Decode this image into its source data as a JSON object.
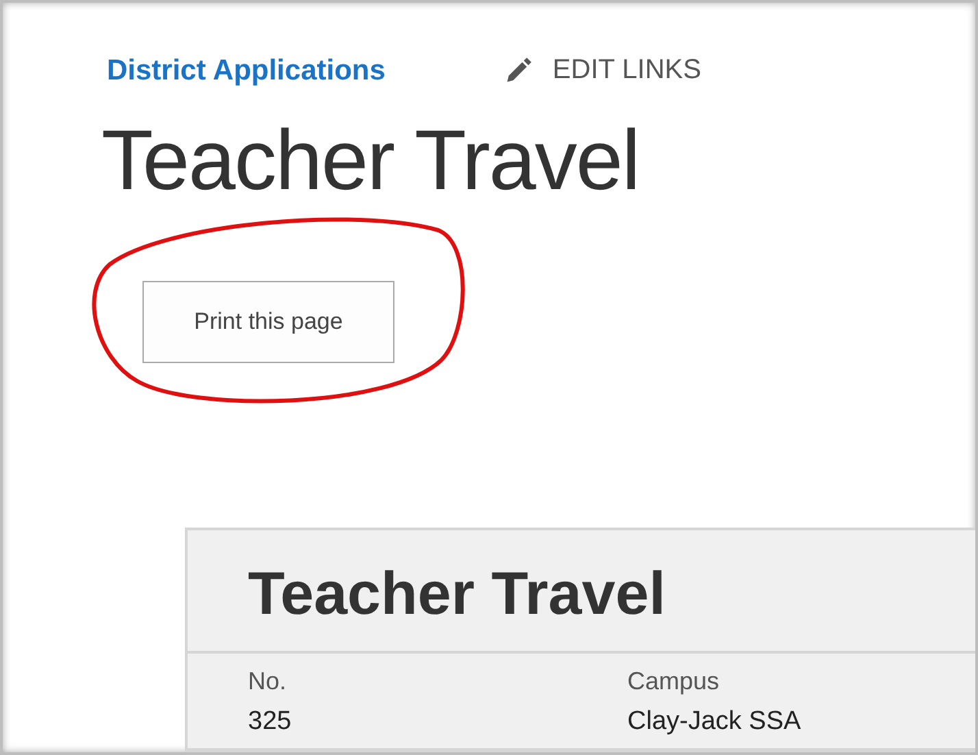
{
  "breadcrumb": {
    "link": "District Applications",
    "edit_links": "EDIT LINKS"
  },
  "page_title": "Teacher Travel",
  "print_button": "Print this page",
  "card": {
    "title": "Teacher Travel",
    "fields": [
      {
        "label": "No.",
        "value": "325"
      },
      {
        "label": "Campus",
        "value": "Clay-Jack SSA"
      }
    ]
  }
}
